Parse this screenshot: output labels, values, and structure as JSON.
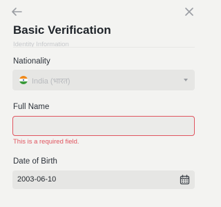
{
  "header": {
    "back_icon": "arrow-left-icon",
    "close_icon": "close-icon",
    "title": "Basic Verification",
    "subtitle": "Identity Information"
  },
  "form": {
    "nationality": {
      "label": "Nationality",
      "value": "India (भारत)",
      "flag_icon": "india-flag-icon",
      "dropdown_icon": "caret-down-icon"
    },
    "full_name": {
      "label": "Full Name",
      "value": "",
      "error": "This is a required field."
    },
    "date_of_birth": {
      "label": "Date of Birth",
      "value": "2003-06-10",
      "calendar_icon": "calendar-icon"
    }
  },
  "colors": {
    "error": "#e0545f",
    "background": "#f3f3f1",
    "input_background": "#e6e6e4",
    "text": "#1e2329"
  }
}
